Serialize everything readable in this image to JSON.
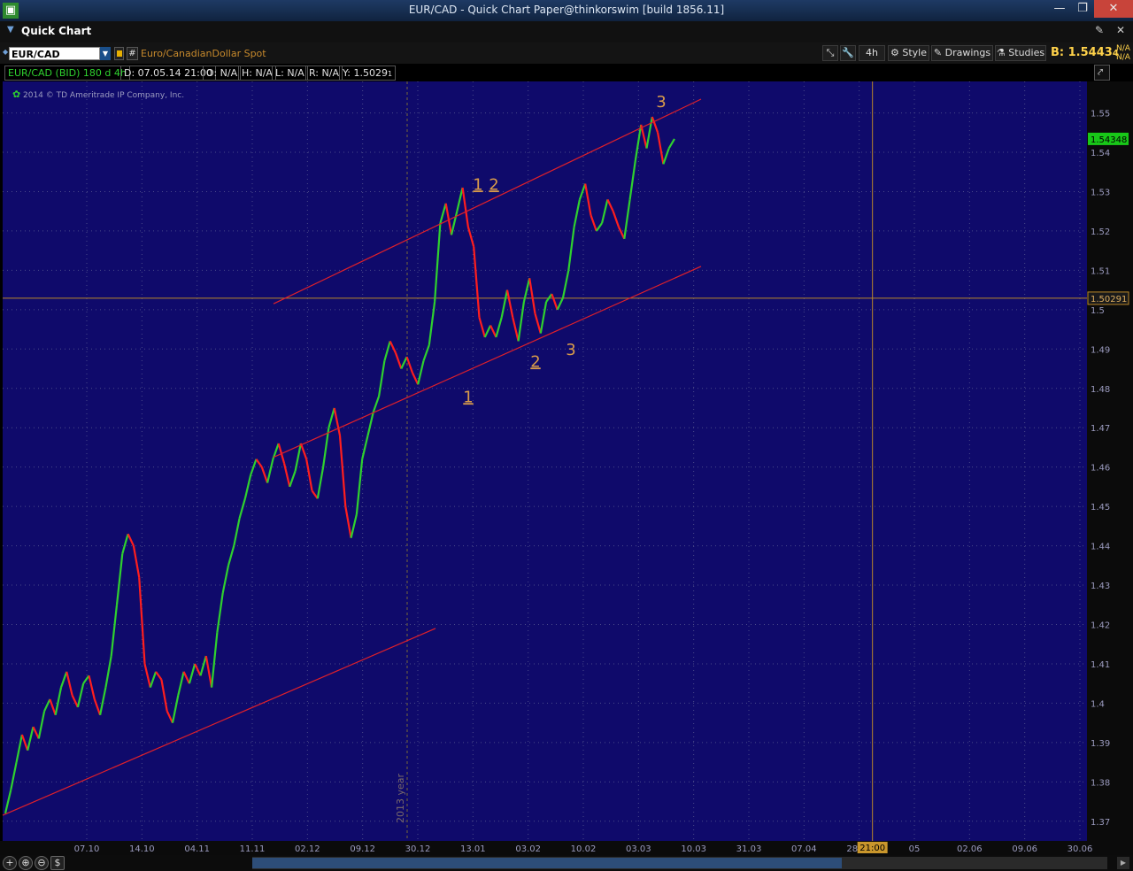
{
  "window": {
    "title": "EUR/CAD - Quick Chart Paper@thinkorswim [build 1856.11]",
    "minimize": "—",
    "maximize": "❐",
    "close": "✕",
    "app_icon": "thinkorswim-icon"
  },
  "header": {
    "title": "Quick Chart",
    "pin": "pin-icon",
    "close": "✕"
  },
  "toolbar": {
    "symbol": "EUR/CAD",
    "description": "Euro/CanadianDollar Spot",
    "aggregation": "4h",
    "style_label": "Style",
    "drawings_label": "Drawings",
    "studies_label": "Studies",
    "bid_label": "B:",
    "bid_main": "1.5443",
    "bid_frac": "4",
    "na_top": "N/A",
    "na_bottom": "N/A"
  },
  "info": {
    "instrument": "EUR/CAD (BID) 180 d 4h",
    "date": "D: 07.05.14 21:00",
    "open": "O: N/A",
    "high": "H: N/A",
    "low": "L: N/A",
    "range": "R: N/A",
    "y": "Y: 1.5029",
    "y_frac": "1"
  },
  "copyright": "2014 © TD Ameritrade IP Company, Inc.",
  "colors": {
    "background": "#0f0a6b",
    "grid": "#4a4a8a",
    "up": "#2fd12f",
    "down": "#ff1e1e",
    "channel": "#e0202a",
    "wave_label": "#d99b4a",
    "axis_text": "#9b9bbf"
  },
  "chart_data": {
    "type": "line",
    "title": "EUR/CAD (BID) 180 d 4h",
    "ylim": [
      1.365,
      1.558
    ],
    "y_ticks": [
      "1.37",
      "1.38",
      "1.39",
      "1.4",
      "1.41",
      "1.42",
      "1.43",
      "1.44",
      "1.45",
      "1.46",
      "1.47",
      "1.48",
      "1.49",
      "1.5",
      "1.51",
      "1.52",
      "1.53",
      "1.54",
      "1.55"
    ],
    "x_labels": [
      "07.10",
      "14.10",
      "04.11",
      "11.11",
      "02.12",
      "09.12",
      "30.12",
      "13.01",
      "03.02",
      "10.02",
      "03.03",
      "10.03",
      "31.03",
      "07.04",
      "28.04",
      "05",
      "02.06",
      "09.06",
      "30.06"
    ],
    "year_marker": "2013 year",
    "crosshair_time": "21:00",
    "crosshair_price": "1.50291",
    "last_price": "1.54348",
    "series": [
      {
        "x_index": 0,
        "values": [
          1.372,
          1.378,
          1.385,
          1.392,
          1.388,
          1.394,
          1.391,
          1.398,
          1.401,
          1.397,
          1.404,
          1.408,
          1.402,
          1.399,
          1.405,
          1.407,
          1.401,
          1.397,
          1.404,
          1.412,
          1.425,
          1.438,
          1.443,
          1.44,
          1.432,
          1.41,
          1.404,
          1.408,
          1.406,
          1.398,
          1.395,
          1.402,
          1.408,
          1.405,
          1.41,
          1.407,
          1.412,
          1.404,
          1.418,
          1.428,
          1.435,
          1.44,
          1.447,
          1.452,
          1.458,
          1.462,
          1.46,
          1.456,
          1.462,
          1.466,
          1.461,
          1.455,
          1.459,
          1.466,
          1.462,
          1.454,
          1.452,
          1.46,
          1.47,
          1.475,
          1.468,
          1.45,
          1.442,
          1.448,
          1.462,
          1.468,
          1.474,
          1.478,
          1.487,
          1.492,
          1.489,
          1.485,
          1.488,
          1.484,
          1.481,
          1.487,
          1.491,
          1.502,
          1.522,
          1.527,
          1.519,
          1.525,
          1.531,
          1.521,
          1.516,
          1.498,
          1.493,
          1.496,
          1.493,
          1.498,
          1.505,
          1.498,
          1.492,
          1.502,
          1.508,
          1.499,
          1.494,
          1.502,
          1.504,
          1.5,
          1.503,
          1.51,
          1.521,
          1.528,
          1.532,
          1.524,
          1.52,
          1.522,
          1.528,
          1.525,
          1.521,
          1.518,
          1.528,
          1.538,
          1.547,
          1.541,
          1.549,
          1.545,
          1.537,
          1.541,
          1.5434
        ]
      }
    ]
  },
  "annotations": {
    "upper_wave_1": "1",
    "upper_wave_2": "2",
    "top_wave_3": "3",
    "low_wave_1": "1",
    "low_wave_2": "2",
    "low_wave_3": "3"
  },
  "bottom": {
    "zoom_in": "+",
    "zoom": "⊕",
    "zoom_out": "⊖",
    "dollar": "$"
  }
}
